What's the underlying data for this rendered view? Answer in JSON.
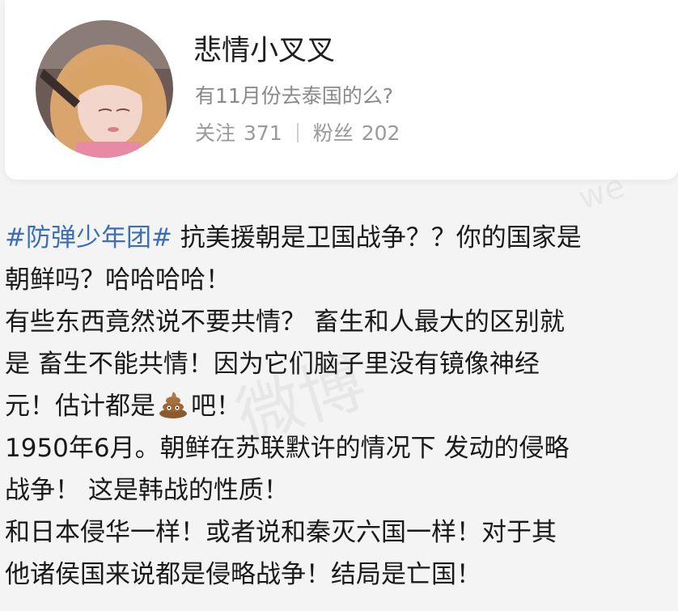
{
  "profile": {
    "username": "悲情小叉叉",
    "bio": "有11月份去泰国的么?",
    "following_label": "关注",
    "following_count": "371",
    "followers_label": "粉丝",
    "followers_count": "202"
  },
  "post": {
    "line1_hashtag": "#防弹少年团#",
    "line1_text": " 抗美援朝是卫国战争？？你的国家是",
    "line2": "朝鲜吗？哈哈哈哈！",
    "line3": "有些东西竟然说不要共情？  畜生和人最大的区别就",
    "line4": "是 畜生不能共情！因为它们脑子里没有镜像神经",
    "line5_before": "元！估计都是",
    "line5_after": "吧！",
    "line6": "1950年6月。朝鲜在苏联默许的情况下 发动的侵略",
    "line7": "战争！  这是韩战的性质！",
    "line8": "和日本侵华一样！或者说和秦灭六国一样！对于其",
    "line9": "他诸侯国来说都是侵略战争！结局是亡国！"
  },
  "watermark": {
    "main": "微博",
    "corner": "we"
  },
  "colors": {
    "hashtag": "#3b6fb6",
    "text": "#1a1a1a",
    "muted": "#8a8a8a"
  },
  "icons": {
    "emoji": "poop-emoji-icon"
  }
}
